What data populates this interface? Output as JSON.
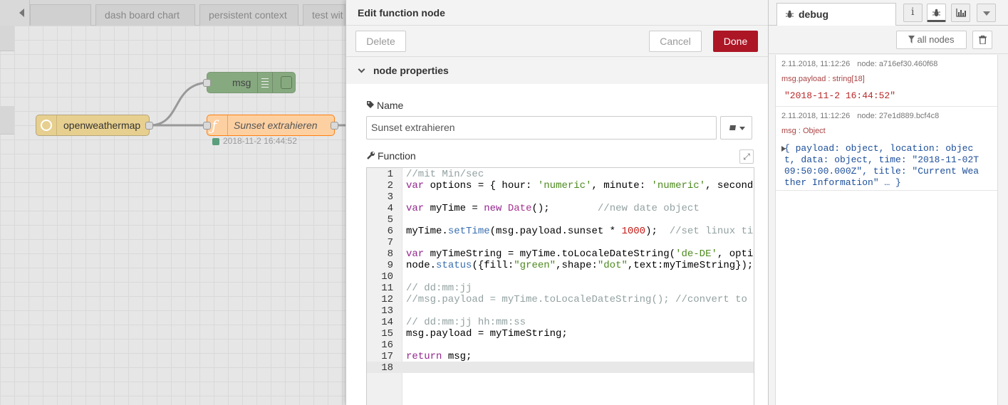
{
  "workspace": {
    "tabs": [
      {
        "label": "dash board chart"
      },
      {
        "label": "persistent context"
      },
      {
        "label": "test wit"
      }
    ],
    "nodes": {
      "msg": {
        "label": "msg"
      },
      "openweathermap": {
        "label": "openweathermap"
      },
      "function": {
        "label": "Sunset extrahieren",
        "status": "2018-11-2 16:44:52"
      }
    }
  },
  "dialog": {
    "title": "Edit function node",
    "delete_label": "Delete",
    "cancel_label": "Cancel",
    "done_label": "Done",
    "section_label": "node properties",
    "name_label": "Name",
    "name_value": "Sunset extrahieren",
    "function_label": "Function",
    "code_lines": [
      "//mit Min/sec",
      "var options = { hour: 'numeric', minute: 'numeric', second",
      "",
      "var myTime = new Date();        //new date object",
      "",
      "myTime.setTime(msg.payload.sunset * 1000);  //set linux ti",
      "",
      "var myTimeString = myTime.toLocaleDateString('de-DE', opti",
      "node.status({fill:\"green\",shape:\"dot\",text:myTimeString});",
      "",
      "// dd:mm:jj",
      "//msg.payload = myTime.toLocaleDateString(); //convert to",
      "",
      "// dd:mm:jj hh:mm:ss",
      "msg.payload = myTimeString;",
      "",
      "return msg;",
      ""
    ],
    "line_numbers": [
      "1",
      "2",
      "3",
      "4",
      "5",
      "6",
      "7",
      "8",
      "9",
      "10",
      "11",
      "12",
      "13",
      "14",
      "15",
      "16",
      "17",
      "18"
    ]
  },
  "sidebar": {
    "tab_label": "debug",
    "filter_label": "all nodes",
    "messages": [
      {
        "timestamp": "2.11.2018, 11:12:26",
        "node": "node: a716ef30.460f68",
        "topic": "msg.payload : string[18]",
        "value": "\"2018-11-2 16:44:52\""
      },
      {
        "timestamp": "2.11.2018, 11:12:26",
        "node": "node: 27e1d889.bcf4c8",
        "topic": "msg : Object",
        "value": "{ payload: object, location: object, data: object, time: \"2018-11-02T09:50:00.000Z\", title: \"Current Weather Information\" … }"
      }
    ]
  },
  "colors": {
    "done_button": "#ad1625",
    "inject_node": "#e7cf8f",
    "function_node": "#fdd0a2",
    "debug_node": "#87a980"
  }
}
